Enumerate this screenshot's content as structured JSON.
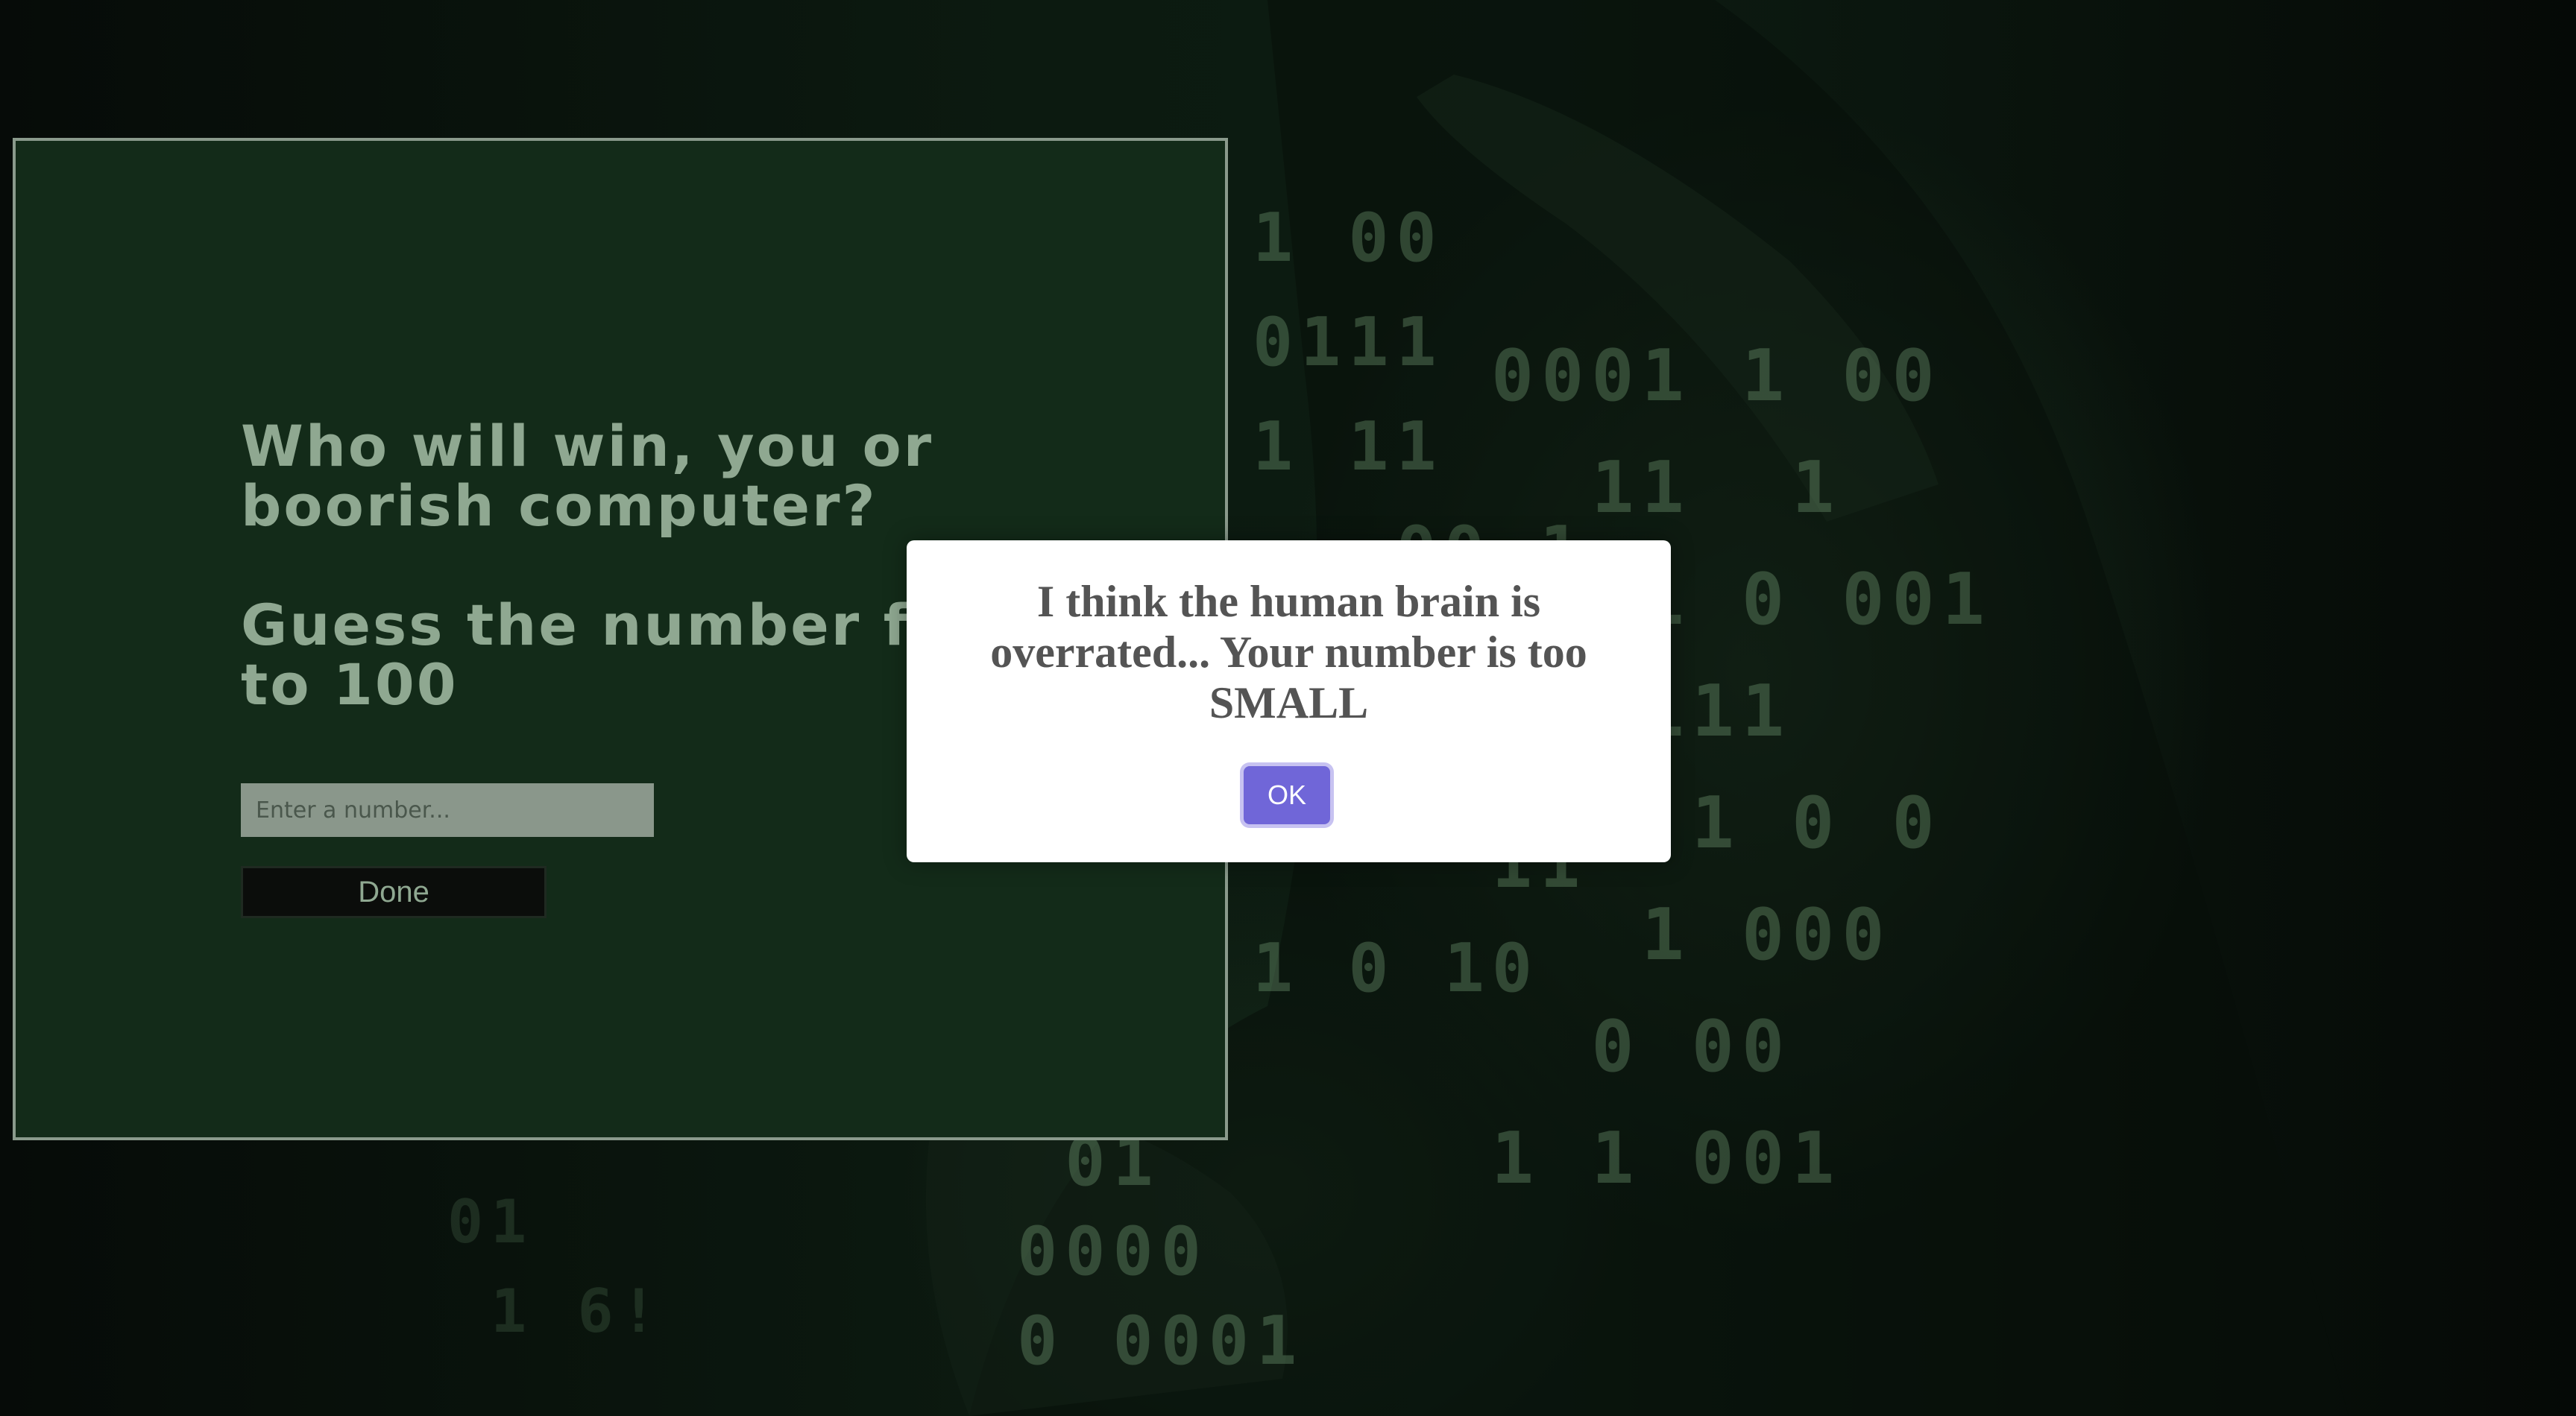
{
  "game": {
    "heading_question": "Who will win, you or\nboorish computer?",
    "heading_instruction": "Guess the number from 1\nto 100",
    "input_placeholder": "Enter a number...",
    "input_value": "",
    "done_label": "Done"
  },
  "dialog": {
    "message": "I think the human brain is overrated... Your number is too SMALL",
    "ok_label": "OK"
  },
  "colors": {
    "panel_background": "#132b19",
    "text_green": "#8fa891",
    "ok_button": "#7066d8"
  }
}
